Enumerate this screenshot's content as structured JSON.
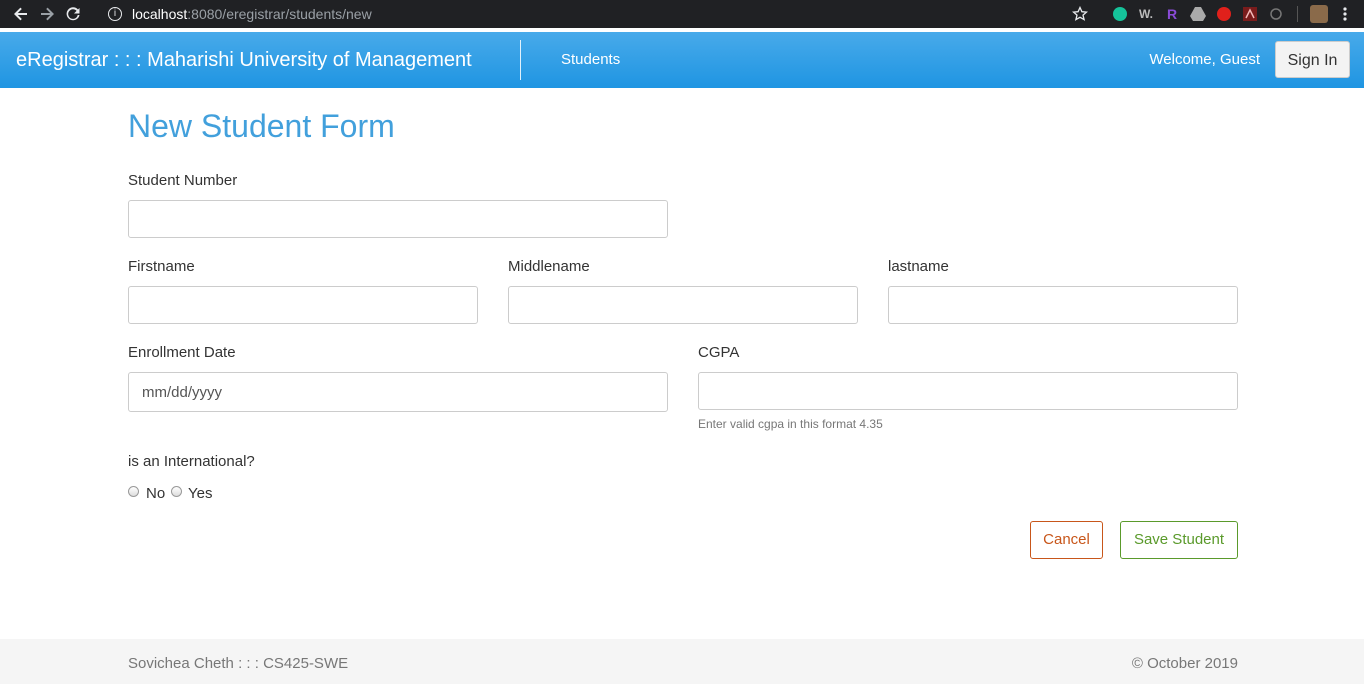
{
  "browser": {
    "url_host": "localhost",
    "url_path": ":8080/eregistrar/students/new"
  },
  "navbar": {
    "brand": "eRegistrar : : : Maharishi University of Management",
    "link_students": "Students",
    "welcome": "Welcome, Guest",
    "sign_in": "Sign In"
  },
  "form": {
    "title": "New Student Form",
    "student_number_label": "Student Number",
    "firstname_label": "Firstname",
    "middlename_label": "Middlename",
    "lastname_label": "lastname",
    "enrollment_date_label": "Enrollment Date",
    "enrollment_date_placeholder": "mm/dd/yyyy",
    "cgpa_label": "CGPA",
    "cgpa_help": "Enter valid cgpa in this format 4.35",
    "international_label": "is an International?",
    "radio_no": "No",
    "radio_yes": "Yes",
    "cancel": "Cancel",
    "save": "Save Student"
  },
  "footer": {
    "left": "Sovichea Cheth : : : CS425-SWE",
    "right": "© October 2019"
  }
}
